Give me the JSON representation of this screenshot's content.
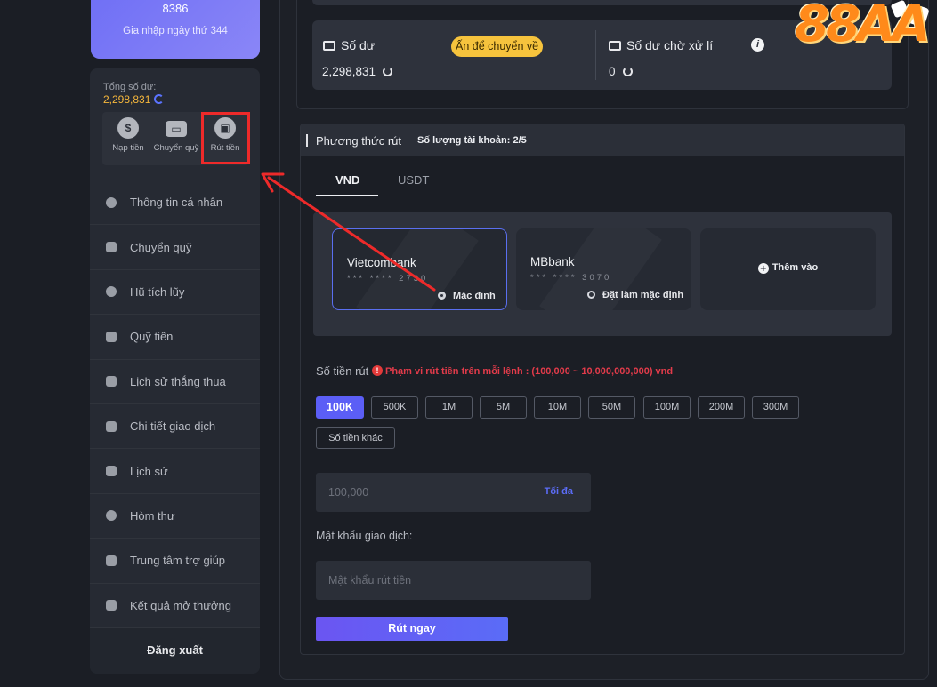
{
  "profile": {
    "uid": "8386",
    "joined": "Gia nhập ngày thứ 344"
  },
  "wallet": {
    "total_label": "Tổng số dư:",
    "total_value": "2,298,831",
    "actions": [
      {
        "label": "Nạp tiền",
        "icon": "deposit-icon"
      },
      {
        "label": "Chuyển quỹ",
        "icon": "wallet-icon"
      },
      {
        "label": "Rút tiền",
        "icon": "withdraw-icon"
      }
    ]
  },
  "menu": [
    {
      "label": "Thông tin cá nhân",
      "icon": "user-icon"
    },
    {
      "label": "Chuyển quỹ",
      "icon": "wallet-icon"
    },
    {
      "label": "Hũ tích lũy",
      "icon": "savings-icon"
    },
    {
      "label": "Quỹ tiền",
      "icon": "fund-icon"
    },
    {
      "label": "Lịch sử thắng thua",
      "icon": "history-icon"
    },
    {
      "label": "Chi tiết giao dịch",
      "icon": "transactions-icon"
    },
    {
      "label": "Lịch sử",
      "icon": "coins-icon"
    },
    {
      "label": "Hòm thư",
      "icon": "bell-icon"
    },
    {
      "label": "Trung tâm trợ giúp",
      "icon": "book-icon"
    },
    {
      "label": "Kết quả mở thưởng",
      "icon": "trophy-icon"
    }
  ],
  "logout_label": "Đăng xuất",
  "balance": {
    "label": "Số dư",
    "value": "2,298,831",
    "transfer_badge": "Ấn để chuyển về",
    "pending_label": "Số dư chờ xử lí",
    "pending_value": "0"
  },
  "logo": {
    "text": "88AA"
  },
  "withdraw": {
    "title": "Phương thức rút",
    "account_count_label": "Số lượng tài khoản:",
    "account_count_value": "2/5",
    "tabs": [
      "VND",
      "USDT"
    ],
    "active_tab": "VND",
    "banks": [
      {
        "name": "Vietcombank",
        "number": "*** **** 2730",
        "status": "Mặc định",
        "selected": true
      },
      {
        "name": "MBbank",
        "number": "*** **** 3070",
        "status": "Đặt làm mặc định",
        "selected": false
      }
    ],
    "add_label": "Thêm vào",
    "amount_label": "Số tiền rút",
    "range_text": "Phạm vi rút tiền trên mỗi lệnh : (100,000 ~ 10,000,000,000) vnd",
    "amounts": [
      "100K",
      "500K",
      "1M",
      "5M",
      "10M",
      "50M",
      "100M",
      "200M",
      "300M"
    ],
    "active_amount": "100K",
    "other_amount": "Số tiền khác",
    "amount_placeholder": "100,000",
    "max_label": "Tối đa",
    "password_label": "Mật khẩu giao dịch:",
    "password_placeholder": "Mật khẩu rút tiền",
    "submit_label": "Rút ngay"
  },
  "colors": {
    "accent": "#5b5ef6",
    "highlight": "#ee2a2a",
    "gold": "#f6b73c",
    "error": "#e23b4a"
  }
}
